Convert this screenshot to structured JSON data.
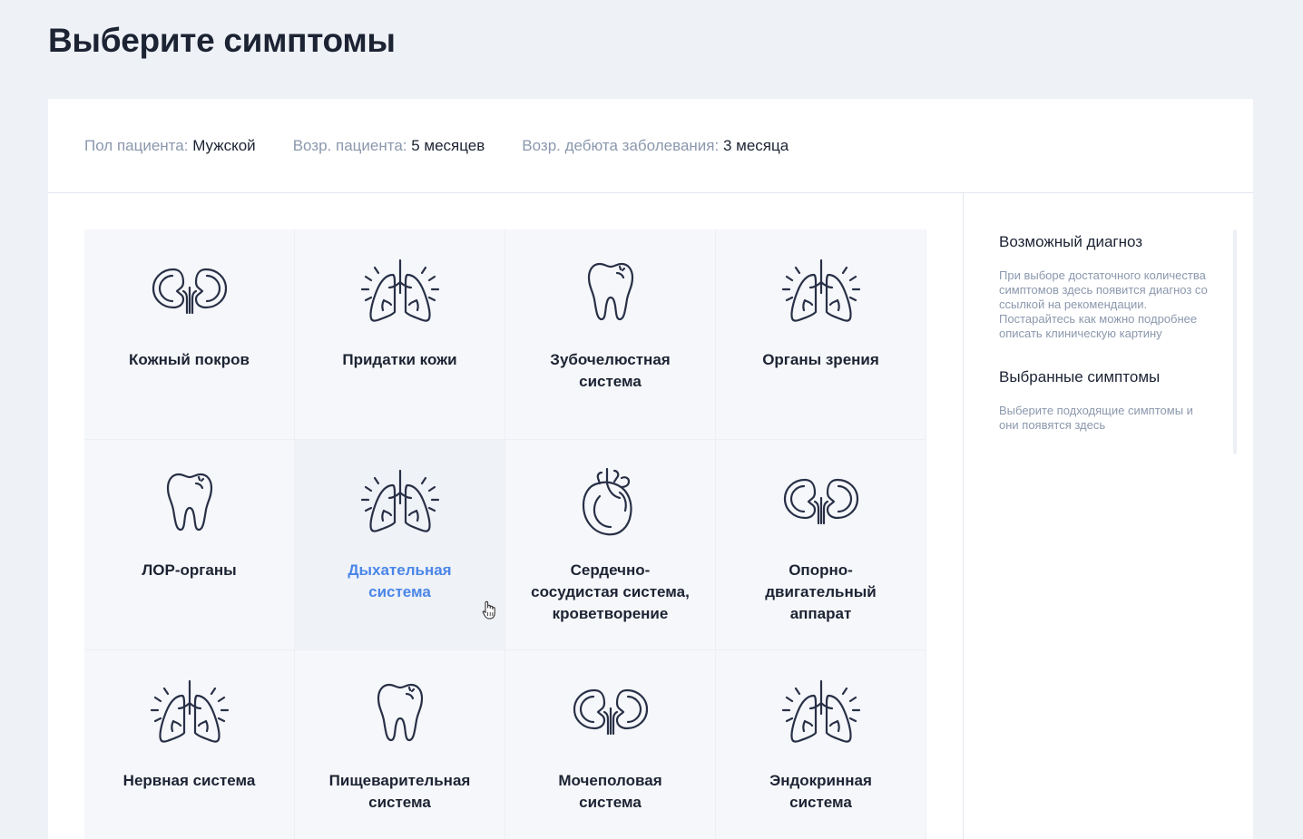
{
  "page": {
    "title": "Выберите симптомы"
  },
  "patient": {
    "sex_label": "Пол пациента:",
    "sex_value": "Мужской",
    "age_label": "Возр. пациента:",
    "age_value": "5 месяцев",
    "onset_label": "Возр. дебюта заболевания:",
    "onset_value": "3 месяца"
  },
  "categories": [
    {
      "label": "Кожный покров",
      "icon": "kidneys-icon"
    },
    {
      "label": "Придатки кожи",
      "icon": "lungs-icon"
    },
    {
      "label": "Зубочелюстная система",
      "icon": "tooth-icon"
    },
    {
      "label": "Органы зрения",
      "icon": "lungs-icon"
    },
    {
      "label": "ЛОР-органы",
      "icon": "tooth-icon"
    },
    {
      "label": "Дыхательная система",
      "icon": "lungs-icon",
      "state": "hover"
    },
    {
      "label": "Сердечно-сосудистая система, кроветворение",
      "icon": "heart-icon"
    },
    {
      "label": "Опорно-двигательный аппарат",
      "icon": "kidneys-icon"
    },
    {
      "label": "Нервная система",
      "icon": "lungs-icon"
    },
    {
      "label": "Пищеварительная система",
      "icon": "tooth-icon"
    },
    {
      "label": "Мочеполовая система",
      "icon": "kidneys-icon"
    },
    {
      "label": "Эндокринная система",
      "icon": "lungs-icon"
    }
  ],
  "sidebar": {
    "diagnosis_title": "Возможный диагноз",
    "diagnosis_text": "При выборе достаточного количества симптомов здесь появится диагноз со ссылкой на рекомендации. Постарайтесь как можно подробнее описать клиническую картину",
    "symptoms_title": "Выбранные симптомы",
    "symptoms_text": "Выберите подходящие симптомы и они появятся здесь"
  },
  "colors": {
    "accent": "#4a86e8",
    "text": "#1c2333",
    "muted": "#8b98ad",
    "background": "#eef1f6",
    "tile": "#f6f7fa"
  }
}
